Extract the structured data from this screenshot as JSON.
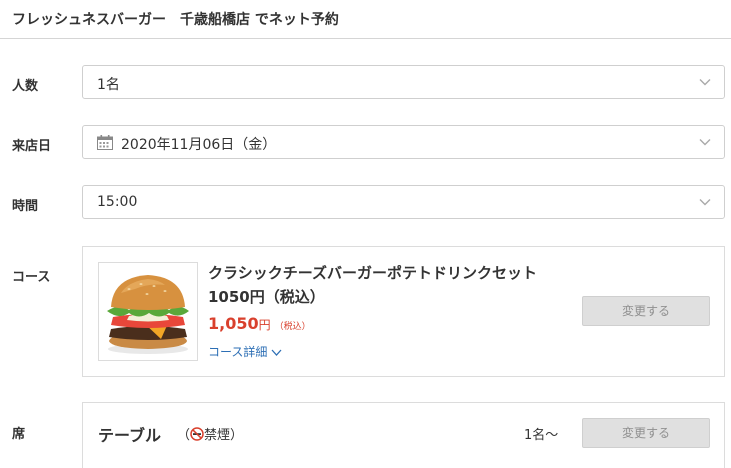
{
  "header": {
    "title": "フレッシュネスバーガー　千歳船橋店 でネット予約"
  },
  "people": {
    "label": "人数",
    "value": "1名"
  },
  "visit_date": {
    "label": "来店日",
    "value": "2020年11月06日（金）"
  },
  "time": {
    "label": "時間",
    "value": "15:00"
  },
  "course": {
    "label": "コース",
    "name": "クラシックチーズバーガーポテトドリンクセット　1050円（税込）",
    "price": "1,050",
    "price_unit": "円",
    "price_tax": "（税込）",
    "detail_link": "コース詳細",
    "change_button": "変更する"
  },
  "seat": {
    "label": "席",
    "name": "テーブル",
    "smoking_open": "（",
    "smoking": "禁煙）",
    "capacity": "1名～",
    "change_button": "変更する"
  },
  "colors": {
    "price": "#d9402d",
    "link": "#2d6fb5",
    "button_bg": "#e0e0e0",
    "button_text": "#8f8f8f"
  }
}
